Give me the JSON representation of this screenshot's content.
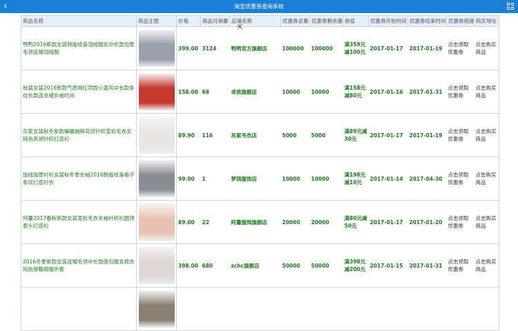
{
  "header": {
    "title": "淘宝优惠券查询系统",
    "back_icon": "chevron-left-icon",
    "menu_icon": "grid-icon"
  },
  "columns": [
    "商品名称",
    "商品主图",
    "价格",
    "商品月销量",
    "店铺名称",
    "优惠券总量",
    "优惠券剩余量",
    "券值",
    "优惠券开始时间",
    "优惠券结束时间",
    "优惠券链接",
    "购买地址"
  ],
  "rows": [
    {
      "name": "鸭鸭2016新款女装韩版修身羽绒服女中长款加厚毛领连帽羽绒服",
      "price": "399.00",
      "sales": "3124",
      "shop": "鸭鸭官方旗舰店",
      "total": "100000",
      "remain": "100000",
      "value": "满359元减100元",
      "start": "2017-01-17",
      "end": "2017-01-19",
      "coupon": "点击领取优惠券",
      "buy": "点击购买商品",
      "color": "#9aa0ab"
    },
    {
      "name": "秋装女装2016新款气质网红同款小香风中长款条纹长款连衣裙长袖时尚",
      "price": "158.00",
      "sales": "68",
      "shop": "卓依旗舰店",
      "total": "10000",
      "remain": "10000",
      "value": "满158元减80元",
      "start": "2017-01-16",
      "end": "2017-01-31",
      "coupon": "点击领取优惠券",
      "buy": "点击购买商品",
      "color": "#c8392d"
    },
    {
      "name": "灰家女装秋冬新款蝙蝠袖麻花纹针织宽松毛衣女纯色高领针织打底衫",
      "price": "89.90",
      "sales": "116",
      "shop": "灰家韦衣店",
      "total": "5000",
      "remain": "5000",
      "value": "满89元减30元",
      "start": "2017-01-17",
      "end": "2017-01-19",
      "coupon": "点击领取优惠券",
      "buy": "点击购买商品",
      "color": "#e8e6e4"
    },
    {
      "name": "加绒加厚衬衫女装秋冬季长袖2016韩版修身格子条纹打底衬衣",
      "price": "99.00",
      "sales": "1",
      "shop": "梦琪服饰店",
      "total": "10000",
      "remain": "10000",
      "value": "满198元减10元",
      "start": "2017-01-14",
      "end": "2017-04-30",
      "coupon": "点击领取优惠券",
      "buy": "点击购买商品",
      "color": "#8c8c94"
    },
    {
      "name": "阿蔓2017春秋新款女装宽松毛衣长袖针织衫圆领套头打底衫",
      "price": "89.00",
      "sales": "22",
      "shop": "阿蔓服饰旗舰店",
      "total": "20000",
      "remain": "20000",
      "value": "满80元减50元",
      "start": "2017-01-17",
      "end": "2017-01-20",
      "coupon": "点击领取优惠券",
      "buy": "点击购买商品",
      "color": "#eac2b4"
    },
    {
      "name": "2016冬季新款女装连帽毛领中长款面包服女棉衣纯色保暖棉服外套",
      "price": "398.00",
      "sales": "680",
      "shop": "zchc旗舰店",
      "total": "50000",
      "remain": "50000",
      "value": "满398元减200元",
      "start": "2017-01-15",
      "end": "2017-01-31",
      "coupon": "点击领取优惠券",
      "buy": "点击购买商品",
      "color": "#dcd6d4"
    },
    {
      "name": "",
      "price": "",
      "sales": "",
      "shop": "",
      "total": "",
      "remain": "",
      "value": "",
      "start": "",
      "end": "",
      "coupon": "",
      "buy": "",
      "color": "#8a8070"
    }
  ]
}
